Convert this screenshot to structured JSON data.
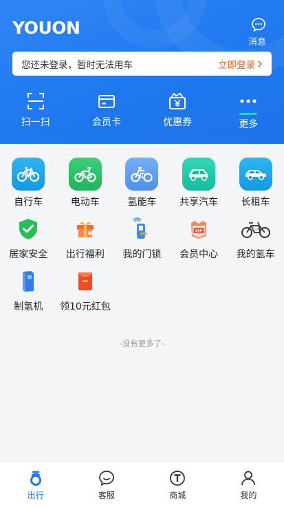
{
  "header": {
    "logo": "YOUON",
    "message_label": "消息",
    "login_bar": {
      "text": "您还未登录，暂时无法用车",
      "action": "立即登录"
    },
    "quick_actions": [
      {
        "label": "扫一扫",
        "icon": "scan-icon"
      },
      {
        "label": "会员卡",
        "icon": "card-icon"
      },
      {
        "label": "优惠券",
        "icon": "coupon-icon"
      },
      {
        "label": "更多",
        "icon": "more-icon"
      }
    ]
  },
  "services": [
    {
      "label": "自行车",
      "icon": "bicycle-icon",
      "color": "#1aa7e8"
    },
    {
      "label": "电动车",
      "icon": "ebike-icon",
      "color": "#2bc46b"
    },
    {
      "label": "氢能车",
      "icon": "hydrogen-bike-icon",
      "color": "#5c9ff0"
    },
    {
      "label": "共享汽车",
      "icon": "shared-car-icon",
      "color": "#20c9a9"
    },
    {
      "label": "长租车",
      "icon": "rental-car-icon",
      "color": "#1aa7e8"
    },
    {
      "label": "居家安全",
      "icon": "shield-check-icon",
      "color": "#2bbd57"
    },
    {
      "label": "出行福利",
      "icon": "gift-icon",
      "color": "#f06a3a"
    },
    {
      "label": "我的门锁",
      "icon": "door-lock-icon",
      "color": "#3a8ef0"
    },
    {
      "label": "会员中心",
      "icon": "vip-icon",
      "color": "#f06a3a"
    },
    {
      "label": "我的氢车",
      "icon": "my-hydrogen-bike-icon",
      "color": "#333333"
    },
    {
      "label": "制氢机",
      "icon": "hydrogen-generator-icon",
      "color": "#2f7ee8"
    },
    {
      "label": "领10元红包",
      "icon": "red-envelope-icon",
      "color": "#f04a2a"
    }
  ],
  "no_more": "-没有更多了-",
  "tabbar": [
    {
      "label": "出行",
      "icon": "travel-icon",
      "active": true
    },
    {
      "label": "客服",
      "icon": "customer-service-icon",
      "active": false
    },
    {
      "label": "商城",
      "icon": "mall-icon",
      "active": false
    },
    {
      "label": "我的",
      "icon": "profile-icon",
      "active": false
    }
  ],
  "colors": {
    "primary": "#1f78ef",
    "accent_orange": "#f0642d",
    "teal": "#22d3c7"
  }
}
